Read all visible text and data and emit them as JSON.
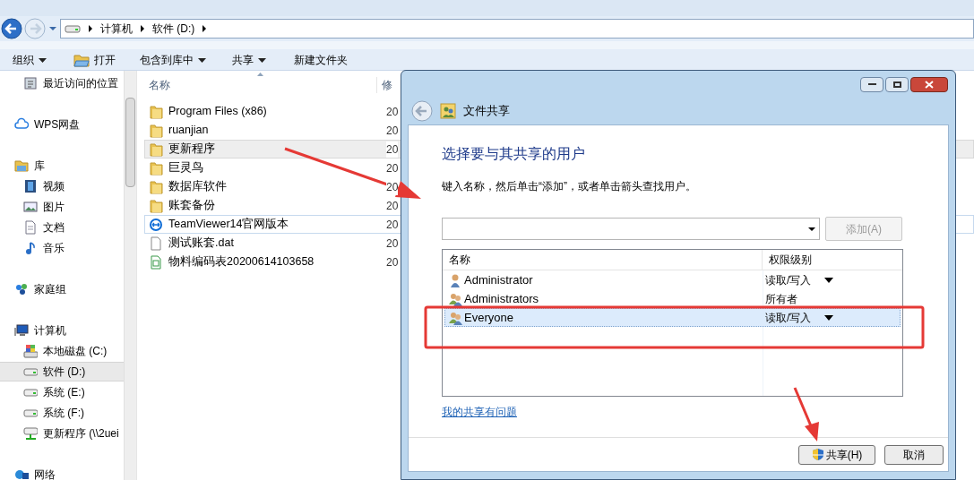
{
  "explorer": {
    "address": [
      "计算机",
      "软件 (D:)"
    ],
    "toolbar": [
      {
        "label": "组织",
        "kind": "menu"
      },
      {
        "label": "打开",
        "kind": "open"
      },
      {
        "label": "包含到库中",
        "kind": "menu"
      },
      {
        "label": "共享",
        "kind": "menu"
      },
      {
        "label": "新建文件夹",
        "kind": "command"
      }
    ],
    "sidebar": [
      {
        "label": "最近访问的位置",
        "kind": "recent",
        "selected": false
      },
      {
        "label": "WPS网盘",
        "kind": "cloud",
        "selected": false
      },
      {
        "label": "库",
        "kind": "library",
        "selected": false,
        "children": [
          {
            "label": "视频",
            "kind": "video",
            "selected": false
          },
          {
            "label": "图片",
            "kind": "picture",
            "selected": false
          },
          {
            "label": "文档",
            "kind": "document",
            "selected": false
          },
          {
            "label": "音乐",
            "kind": "music",
            "selected": false
          }
        ]
      },
      {
        "label": "家庭组",
        "kind": "homegroup",
        "selected": false
      },
      {
        "label": "计算机",
        "kind": "computer",
        "selected": false,
        "children": [
          {
            "label": "本地磁盘 (C:)",
            "kind": "system-drive",
            "selected": false
          },
          {
            "label": "软件 (D:)",
            "kind": "drive",
            "selected": true
          },
          {
            "label": "系统 (E:)",
            "kind": "drive",
            "selected": false
          },
          {
            "label": "系统 (F:)",
            "kind": "drive",
            "selected": false
          },
          {
            "label": "更新程序 (\\\\2uei",
            "kind": "network-drive",
            "selected": false
          }
        ]
      },
      {
        "label": "网络",
        "kind": "network",
        "selected": false
      }
    ],
    "columns": [
      "名称",
      "修"
    ],
    "files": [
      {
        "name": "Program Files (x86)",
        "kind": "folder",
        "date": "20",
        "hovered": false,
        "focused": false
      },
      {
        "name": "ruanjian",
        "kind": "folder",
        "date": "20",
        "hovered": false,
        "focused": false
      },
      {
        "name": "更新程序",
        "kind": "folder",
        "date": "20",
        "hovered": true,
        "focused": false
      },
      {
        "name": "巨灵鸟",
        "kind": "folder",
        "date": "20",
        "hovered": false,
        "focused": false
      },
      {
        "name": "数据库软件",
        "kind": "folder",
        "date": "20",
        "hovered": false,
        "focused": false
      },
      {
        "name": "账套备份",
        "kind": "folder",
        "date": "20",
        "hovered": false,
        "focused": false
      },
      {
        "name": "TeamViewer14官网版本",
        "kind": "app",
        "date": "20",
        "hovered": false,
        "focused": true
      },
      {
        "name": "测试账套.dat",
        "kind": "file",
        "date": "20",
        "hovered": false,
        "focused": false
      },
      {
        "name": "物料编码表20200614103658",
        "kind": "sheet",
        "date": "20",
        "hovered": false,
        "focused": false
      }
    ]
  },
  "dialog": {
    "title": "文件共享",
    "heading": "选择要与其共享的用户",
    "instruction": "键入名称，然后单击“添加”，或者单击箭头查找用户。",
    "add_button": {
      "label": "添加(A)",
      "disabled": true
    },
    "columns": [
      "名称",
      "权限级别"
    ],
    "users": [
      {
        "name": "Administrator",
        "kind": "user",
        "permission": "读取/写入",
        "dropdown": true,
        "selected": false
      },
      {
        "name": "Administrators",
        "kind": "group",
        "permission": "所有者",
        "dropdown": false,
        "selected": false
      },
      {
        "name": "Everyone",
        "kind": "group",
        "permission": "读取/写入",
        "dropdown": true,
        "selected": true
      }
    ],
    "link": "我的共享有问题",
    "buttons": [
      {
        "label": "共享(H)",
        "shield": true
      },
      {
        "label": "取消",
        "shield": false
      }
    ]
  }
}
